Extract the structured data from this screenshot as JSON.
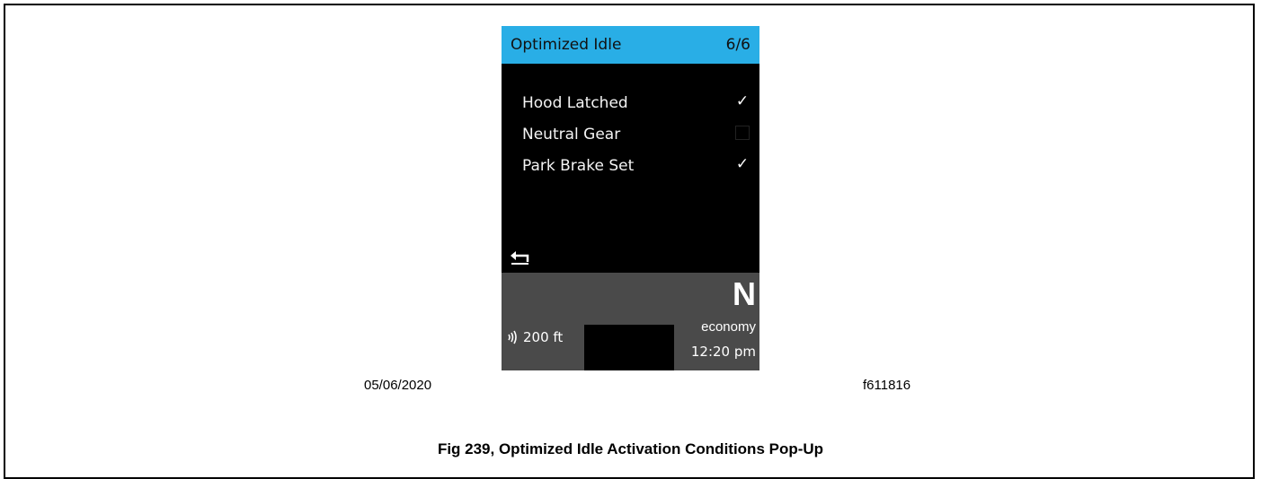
{
  "screen": {
    "header": {
      "title": "Optimized Idle",
      "page": "6/6"
    },
    "conditions": [
      {
        "label": "Hood Latched",
        "checked": true,
        "mark": "✓"
      },
      {
        "label": "Neutral Gear",
        "checked": false,
        "mark": ""
      },
      {
        "label": "Park Brake Set",
        "checked": true,
        "mark": "✓"
      }
    ],
    "status_bar": {
      "gear": "N",
      "mode": "economy",
      "time": "12:20 pm",
      "distance": "200 ft"
    },
    "icons": {
      "back": "back-arrow-icon",
      "signal": "wireless-signal-icon",
      "check": "checkmark-icon"
    },
    "colors": {
      "header_bg": "#29aee6",
      "screen_bg": "#000000",
      "status_bg": "#4a4a4a"
    }
  },
  "figure": {
    "date": "05/06/2020",
    "id": "f611816",
    "caption": "Fig 239, Optimized Idle Activation Conditions Pop-Up"
  }
}
